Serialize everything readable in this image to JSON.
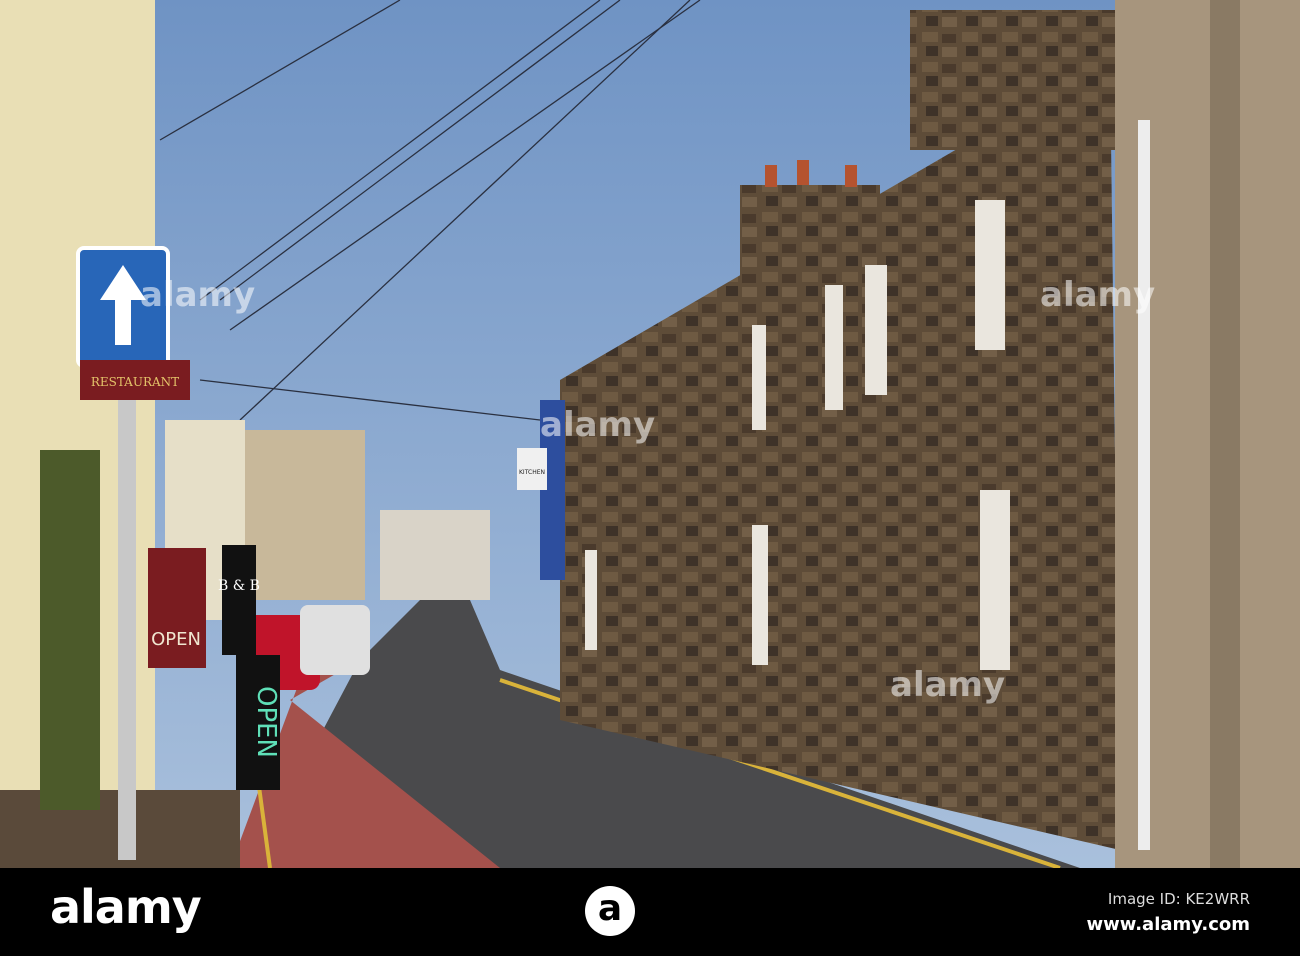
{
  "photo": {
    "signs": {
      "restaurant": "RESTAURANT",
      "bnb": "B & B",
      "open_board": "OPEN",
      "open_sign": "OPEN",
      "kitchen": "KITCHEN"
    },
    "watermark": "alamy"
  },
  "footer": {
    "logo": "alamy",
    "logo_mark": "a",
    "image_id": "Image ID: KE2WRR",
    "url": "www.alamy.com"
  }
}
